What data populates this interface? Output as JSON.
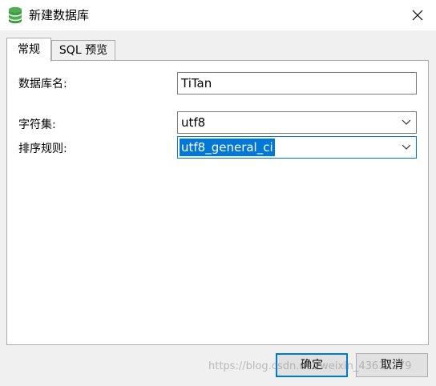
{
  "window": {
    "title": "新建数据库",
    "icon": "database-icon",
    "close_icon": "close-icon"
  },
  "tabs": [
    {
      "label": "常规",
      "active": true
    },
    {
      "label": "SQL 预览",
      "active": false
    }
  ],
  "form": {
    "db_name": {
      "label": "数据库名:",
      "value": "TiTan"
    },
    "charset": {
      "label": "字符集:",
      "value": "utf8"
    },
    "collation": {
      "label": "排序规则:",
      "value": "utf8_general_ci"
    }
  },
  "buttons": {
    "ok": "确定",
    "cancel": "取消"
  },
  "watermark": "https://blog.csdn.net/weixin_43614279",
  "colors": {
    "accent": "#0078d7",
    "db_icon": "#4caf50",
    "border": "#adadad"
  }
}
